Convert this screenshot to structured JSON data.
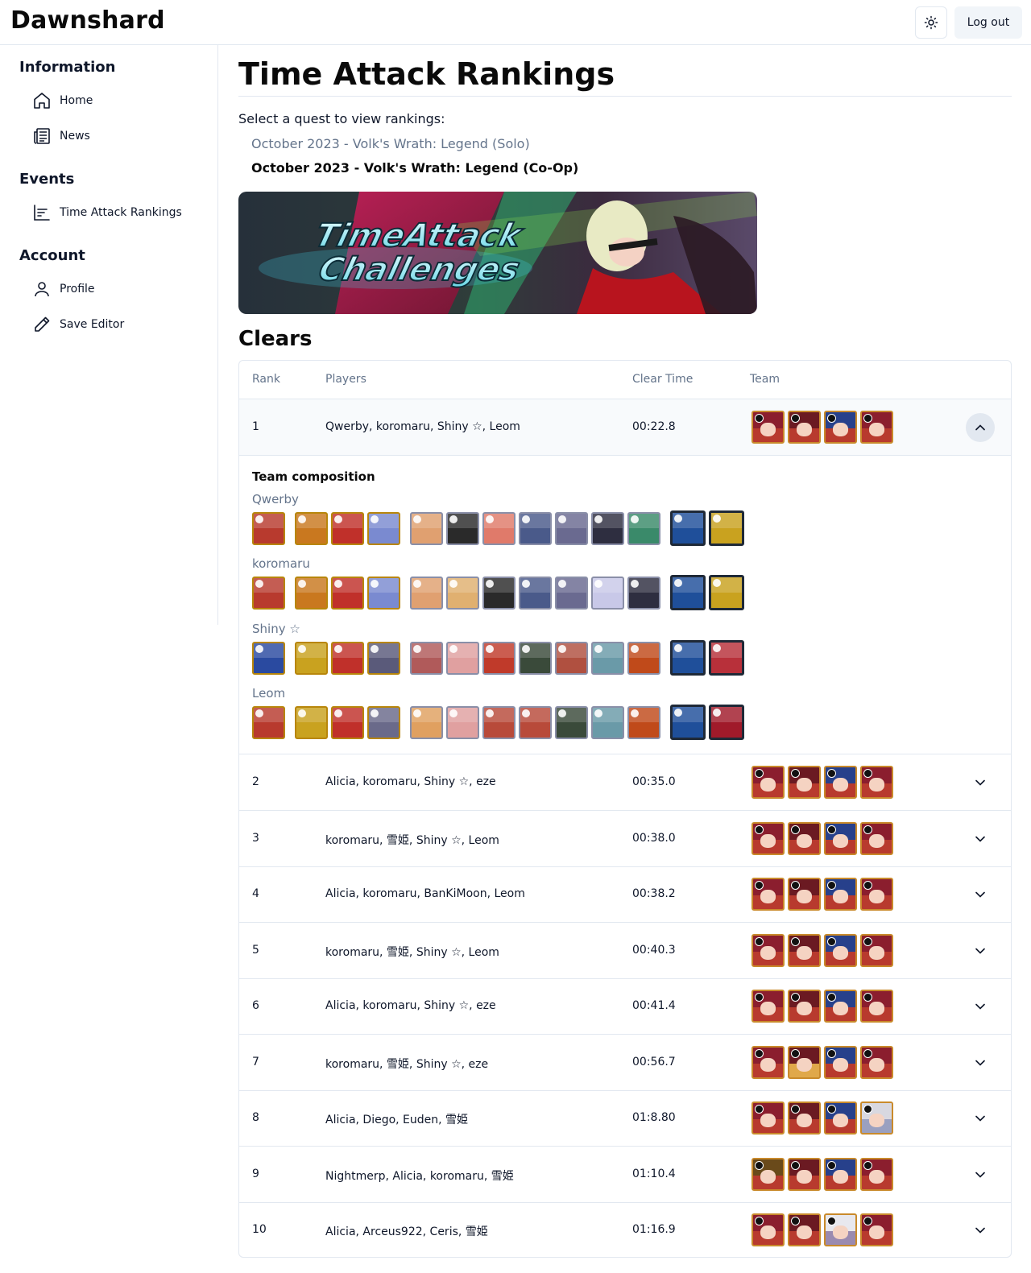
{
  "app": {
    "brand": "Dawnshard",
    "logout_label": "Log out"
  },
  "sidebar": {
    "sections": [
      {
        "heading": "Information",
        "items": [
          {
            "label": "Home",
            "icon": "home-icon"
          },
          {
            "label": "News",
            "icon": "newspaper-icon"
          }
        ]
      },
      {
        "heading": "Events",
        "items": [
          {
            "label": "Time Attack Rankings",
            "icon": "bar-chart-icon"
          }
        ]
      },
      {
        "heading": "Account",
        "items": [
          {
            "label": "Profile",
            "icon": "user-icon"
          },
          {
            "label": "Save Editor",
            "icon": "pencil-icon"
          }
        ]
      }
    ]
  },
  "main": {
    "title": "Time Attack Rankings",
    "select_label": "Select a quest to view rankings:",
    "quests": [
      {
        "label": "October 2023 - Volk's Wrath: Legend (Solo)",
        "active": false
      },
      {
        "label": "October 2023 - Volk's Wrath: Legend (Co-Op)",
        "active": true
      }
    ],
    "banner": {
      "line1": "TimeAttack",
      "line2": "Challenges"
    },
    "clears_title": "Clears",
    "table": {
      "headers": {
        "rank": "Rank",
        "players": "Players",
        "clear_time": "Clear Time",
        "team": "Team"
      },
      "team_composition_title": "Team composition",
      "composition": [
        {
          "player": "Qwerby"
        },
        {
          "player": "koromaru"
        },
        {
          "player": "Shiny ☆"
        },
        {
          "player": "Leom"
        }
      ],
      "rows": [
        {
          "rank": "1",
          "players": "Qwerby, koromaru, Shiny ☆, Leom",
          "time": "00:22.8",
          "expanded": true
        },
        {
          "rank": "2",
          "players": "Alicia, koromaru, Shiny ☆, eze",
          "time": "00:35.0",
          "expanded": false
        },
        {
          "rank": "3",
          "players": "koromaru, 雪姫, Shiny ☆, Leom",
          "time": "00:38.0",
          "expanded": false
        },
        {
          "rank": "4",
          "players": "Alicia, koromaru, BanKiMoon, Leom",
          "time": "00:38.2",
          "expanded": false
        },
        {
          "rank": "5",
          "players": "koromaru, 雪姫, Shiny ☆, Leom",
          "time": "00:40.3",
          "expanded": false
        },
        {
          "rank": "6",
          "players": "Alicia, koromaru, Shiny ☆, eze",
          "time": "00:41.4",
          "expanded": false
        },
        {
          "rank": "7",
          "players": "koromaru, 雪姫, Shiny ☆, eze",
          "time": "00:56.7",
          "expanded": false
        },
        {
          "rank": "8",
          "players": "Alicia, Diego, Euden, 雪姫",
          "time": "01:8.80",
          "expanded": false
        },
        {
          "rank": "9",
          "players": "Nightmerp, Alicia, koromaru, 雪姫",
          "time": "01:10.4",
          "expanded": false
        },
        {
          "rank": "10",
          "players": "Alicia, Arceus922, Ceris, 雪姫",
          "time": "01:16.9",
          "expanded": false
        }
      ]
    }
  },
  "colors": {
    "muted": "#64748b",
    "border": "#e2e8f0",
    "accent_gold": "#c98a2b"
  }
}
